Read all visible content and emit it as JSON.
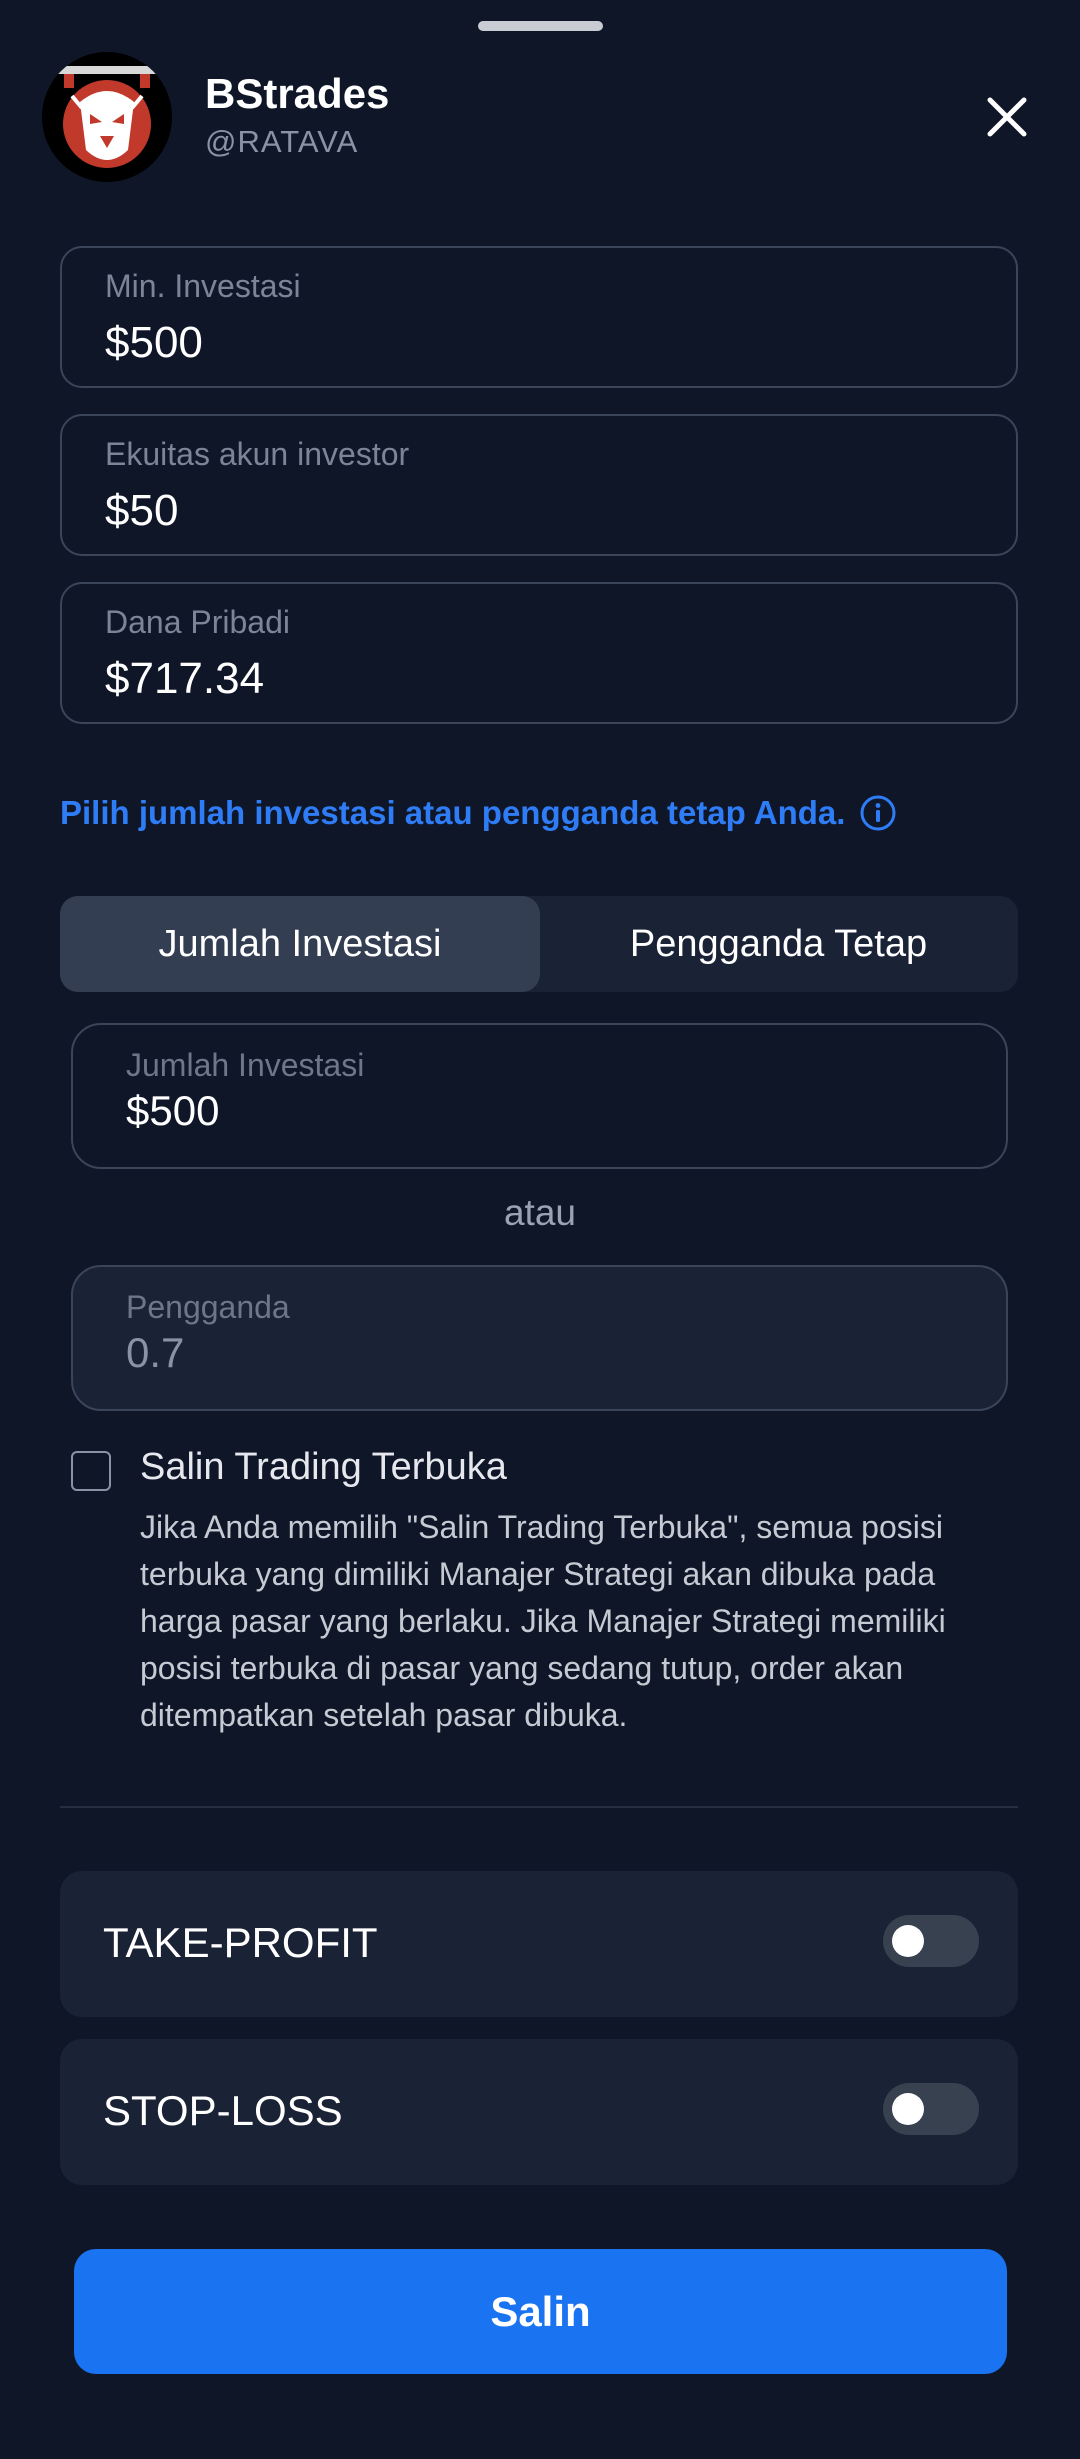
{
  "header": {
    "name": "BStrades",
    "handle": "@RATAVA"
  },
  "info": {
    "min_investment": {
      "label": "Min. Investasi",
      "value": "$500"
    },
    "investor_equity": {
      "label": "Ekuitas akun investor",
      "value": "$50"
    },
    "personal_funds": {
      "label": "Dana Pribadi",
      "value": "$717.34"
    }
  },
  "hint": "Pilih jumlah investasi atau pengganda tetap Anda.",
  "tabs": [
    {
      "label": "Jumlah Investasi",
      "active": true
    },
    {
      "label": "Pengganda Tetap",
      "active": false
    }
  ],
  "amount_input": {
    "label": "Jumlah Investasi",
    "value": "$500"
  },
  "or_text": "atau",
  "multiplier_input": {
    "label": "Pengganda",
    "value": "0.7"
  },
  "copy_open": {
    "checked": false,
    "title": "Salin Trading Terbuka",
    "description": "Jika Anda memilih \"Salin Trading Terbuka\", semua posisi terbuka yang dimiliki Manajer Strategi akan dibuka pada harga pasar yang berlaku. Jika Manajer Strategi memiliki posisi terbuka di pasar yang sedang tutup, order akan ditempatkan setelah pasar dibuka."
  },
  "take_profit": {
    "label": "TAKE-PROFIT",
    "enabled": false
  },
  "stop_loss": {
    "label": "STOP-LOSS",
    "enabled": false
  },
  "copy_button": "Salin",
  "colors": {
    "background": "#0f1628",
    "accent": "#1a73f0",
    "hint_text": "#2f7df6",
    "card": "#1a2236"
  },
  "icons": {
    "close": "close-icon",
    "info": "info-circle-icon",
    "avatar": "mask-avatar"
  }
}
